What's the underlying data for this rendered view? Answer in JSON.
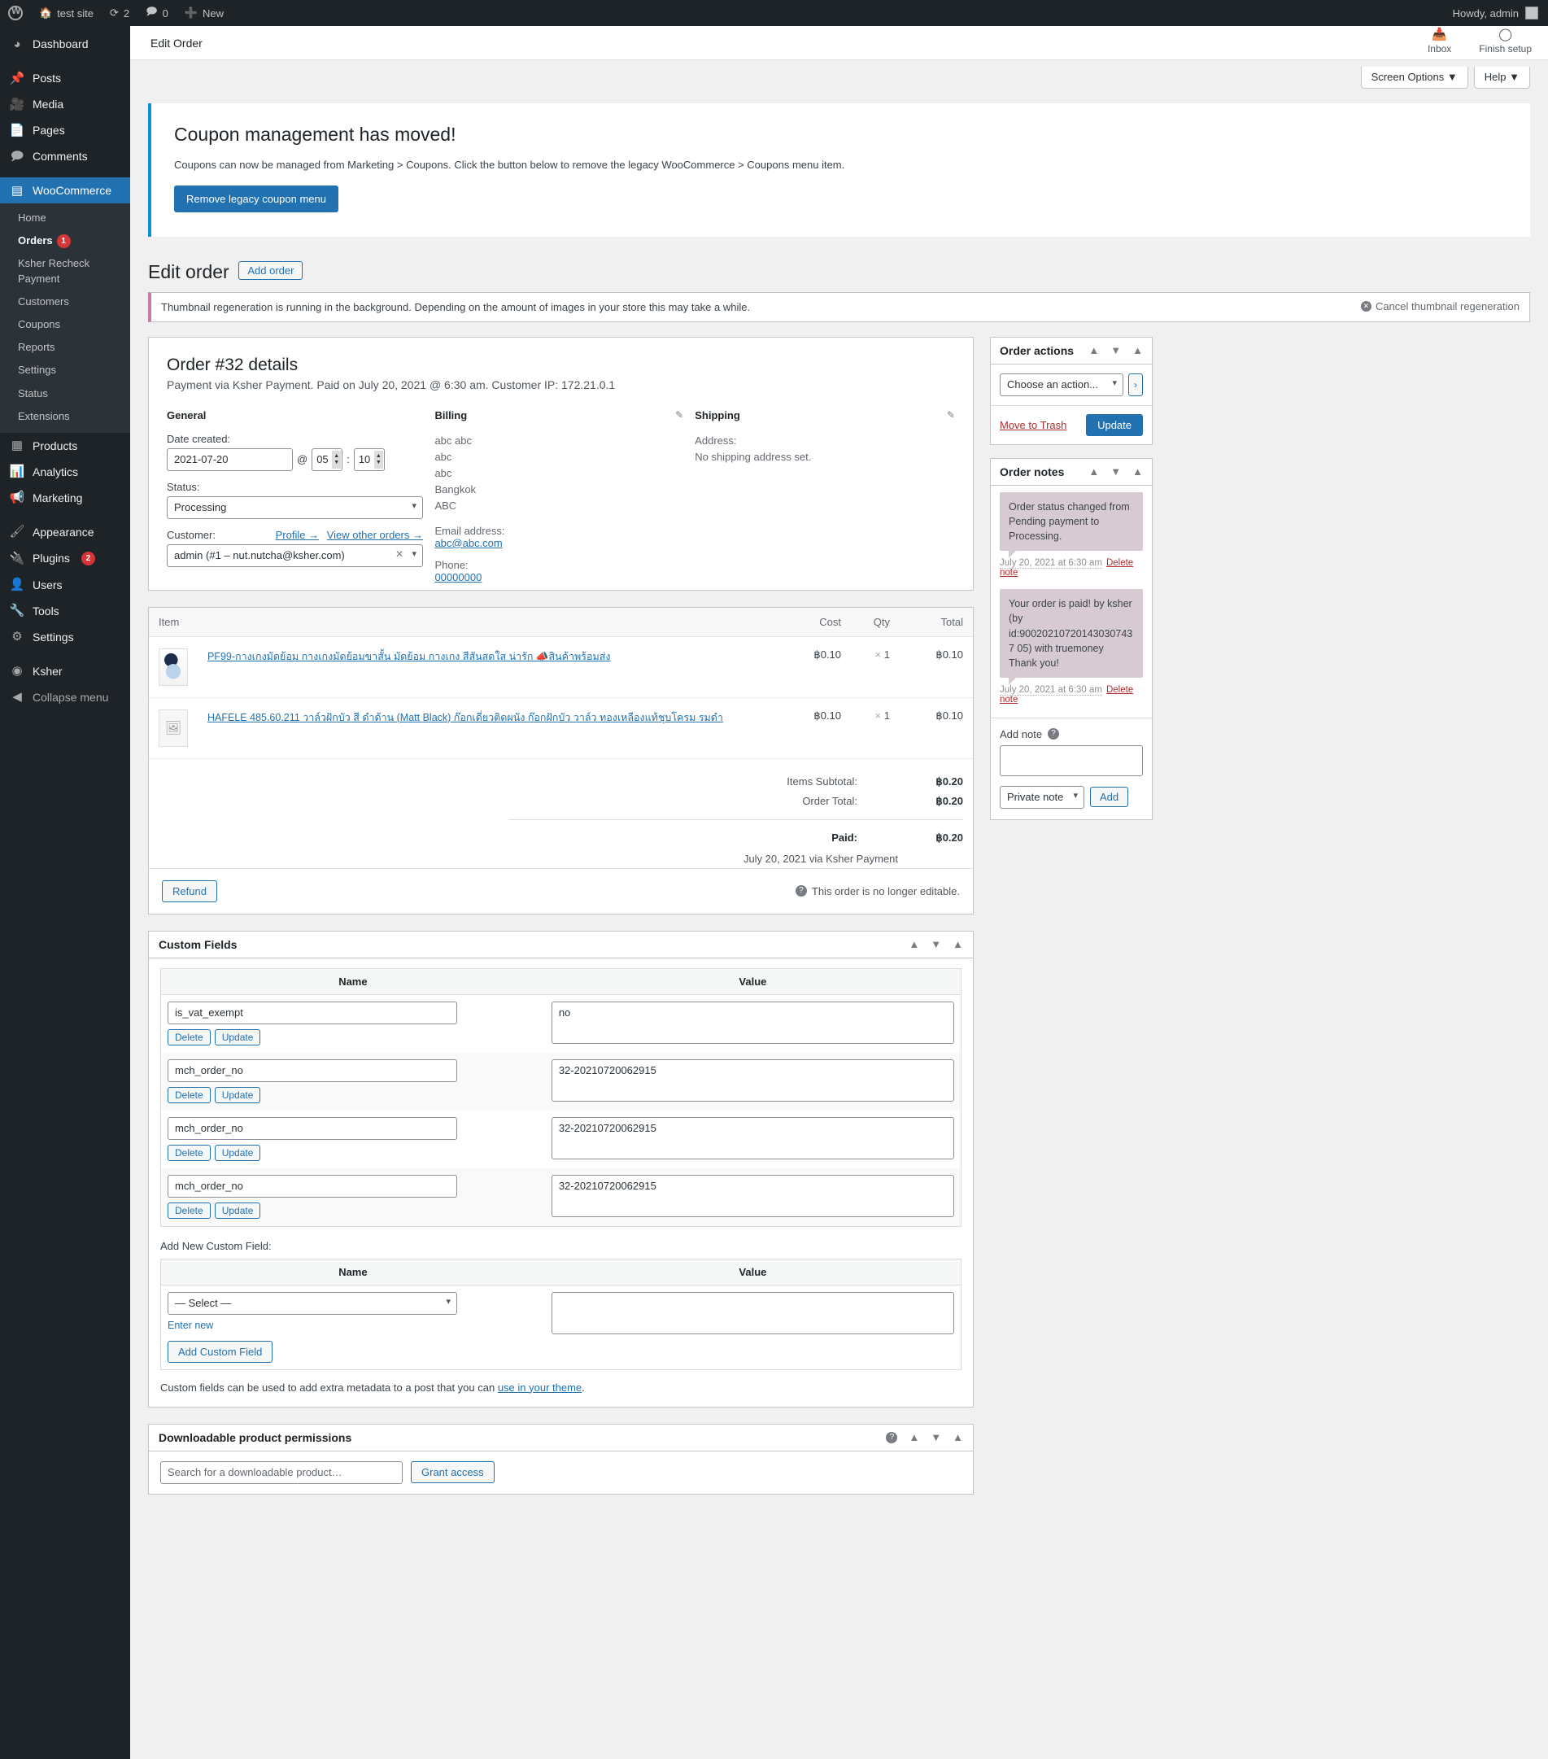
{
  "adminbar": {
    "wp_logo": "wordpress-icon",
    "site_name": "test site",
    "updates_count": "2",
    "comments_count": "0",
    "new_label": "New",
    "howdy": "Howdy, admin"
  },
  "sidebar": {
    "items": [
      {
        "label": "Dashboard",
        "icon": "dashboard-icon"
      },
      {
        "label": "Posts",
        "icon": "pin-icon"
      },
      {
        "label": "Media",
        "icon": "media-icon"
      },
      {
        "label": "Pages",
        "icon": "pages-icon"
      },
      {
        "label": "Comments",
        "icon": "comment-icon"
      },
      {
        "label": "WooCommerce",
        "icon": "woo-icon",
        "current": true
      },
      {
        "label": "Products",
        "icon": "products-icon"
      },
      {
        "label": "Analytics",
        "icon": "analytics-icon"
      },
      {
        "label": "Marketing",
        "icon": "megaphone-icon"
      },
      {
        "label": "Appearance",
        "icon": "brush-icon"
      },
      {
        "label": "Plugins",
        "icon": "plugin-icon",
        "badge": "2"
      },
      {
        "label": "Users",
        "icon": "users-icon"
      },
      {
        "label": "Tools",
        "icon": "tools-icon"
      },
      {
        "label": "Settings",
        "icon": "settings-icon"
      },
      {
        "label": "Ksher",
        "icon": "ksher-icon"
      }
    ],
    "woo_submenu": [
      {
        "label": "Home"
      },
      {
        "label": "Orders",
        "badge": "1",
        "current": true
      },
      {
        "label": "Ksher Recheck Payment"
      },
      {
        "label": "Customers"
      },
      {
        "label": "Coupons"
      },
      {
        "label": "Reports"
      },
      {
        "label": "Settings"
      },
      {
        "label": "Status"
      },
      {
        "label": "Extensions"
      }
    ],
    "collapse": "Collapse menu"
  },
  "header": {
    "page_name": "Edit Order",
    "inbox": "Inbox",
    "finish_setup": "Finish setup",
    "screen_options": "Screen Options",
    "help": "Help"
  },
  "coupon_notice": {
    "title": "Coupon management has moved!",
    "body": "Coupons can now be managed from Marketing > Coupons. Click the button below to remove the legacy WooCommerce > Coupons menu item.",
    "button": "Remove legacy coupon menu"
  },
  "page": {
    "title": "Edit order",
    "add_order": "Add order"
  },
  "thumb_notice": {
    "text": "Thumbnail regeneration is running in the background. Depending on the amount of images in your store this may take a while.",
    "cancel": "Cancel thumbnail regeneration"
  },
  "order": {
    "heading": "Order #32 details",
    "subtitle": "Payment via Ksher Payment. Paid on July 20, 2021 @ 6:30 am. Customer IP: 172.21.0.1",
    "general": {
      "title": "General",
      "date_label": "Date created:",
      "date_value": "2021-07-20",
      "at": "@",
      "hour": "05",
      "minute": "10",
      "status_label": "Status:",
      "status_value": "Processing",
      "customer_label": "Customer:",
      "profile_link": "Profile →",
      "other_orders_link": "View other orders →",
      "customer_value": "admin (#1 – nut.nutcha@ksher.com)"
    },
    "billing": {
      "title": "Billing",
      "address_lines": [
        "abc abc",
        "abc",
        "abc",
        "Bangkok",
        "ABC"
      ],
      "email_label": "Email address:",
      "email": "abc@abc.com",
      "phone_label": "Phone:",
      "phone": "00000000"
    },
    "shipping": {
      "title": "Shipping",
      "address_label": "Address:",
      "address_value": "No shipping address set."
    },
    "items_table": {
      "headers": [
        "Item",
        "Cost",
        "Qty",
        "Total"
      ],
      "rows": [
        {
          "name": "PF99-กางเกงมัดย้อม กางเกงมัดย้อมขาสั้น มัดย้อม กางเกง สีสันสดใส น่ารัก 📣สินค้าพร้อมส่ง",
          "cost": "฿0.10",
          "qty": "1",
          "total": "฿0.10",
          "thumb": "product-photo"
        },
        {
          "name": "HAFELE 485.60.211 วาล์วฝักบัว สี ดำด้าน (Matt Black) ก๊อกเดี่ยวติดผนัง ก๊อกฝักบัว วาล์ว ทองเหลืองแท้ชุบโครม รมดำ",
          "cost": "฿0.10",
          "qty": "1",
          "total": "฿0.10",
          "thumb": "placeholder-image"
        }
      ]
    },
    "totals": {
      "items_subtotal_label": "Items Subtotal:",
      "items_subtotal_value": "฿0.20",
      "order_total_label": "Order Total:",
      "order_total_value": "฿0.20",
      "paid_label": "Paid:",
      "paid_value": "฿0.20",
      "paid_note": "July 20, 2021 via Ksher Payment"
    },
    "footer": {
      "refund": "Refund",
      "not_editable": "This order is no longer editable."
    }
  },
  "order_actions": {
    "title": "Order actions",
    "select_value": "Choose an action...",
    "go": "›",
    "trash": "Move to Trash",
    "update": "Update"
  },
  "order_notes": {
    "title": "Order notes",
    "notes": [
      {
        "text": "Order status changed from Pending payment to Processing.",
        "date": "July 20, 2021 at 6:30 am",
        "delete": "Delete note"
      },
      {
        "text": "Your order is paid! by ksher (by id:900202107201430307437 05) with truemoney Thank you!",
        "date": "July 20, 2021 at 6:30 am",
        "delete": "Delete note"
      }
    ],
    "add_note_label": "Add note",
    "note_value": "",
    "note_type": "Private note",
    "add_button": "Add"
  },
  "custom_fields": {
    "title": "Custom Fields",
    "headers": {
      "name": "Name",
      "value": "Value"
    },
    "rows": [
      {
        "name": "is_vat_exempt",
        "value": "no",
        "delete": "Delete",
        "update": "Update"
      },
      {
        "name": "mch_order_no",
        "value": "32-20210720062915",
        "delete": "Delete",
        "update": "Update"
      },
      {
        "name": "mch_order_no",
        "value": "32-20210720062915",
        "delete": "Delete",
        "update": "Update"
      },
      {
        "name": "mch_order_no",
        "value": "32-20210720062915",
        "delete": "Delete",
        "update": "Update"
      }
    ],
    "add_new_label": "Add New Custom Field:",
    "select_value": "— Select —",
    "new_value": "",
    "enter_new": "Enter new",
    "add_button": "Add Custom Field",
    "help_text": "Custom fields can be used to add extra metadata to a post that you can ",
    "help_link": "use in your theme",
    "help_tail": "."
  },
  "downloadable": {
    "title": "Downloadable product permissions",
    "search_placeholder": "Search for a downloadable product…",
    "grant_access": "Grant access"
  }
}
